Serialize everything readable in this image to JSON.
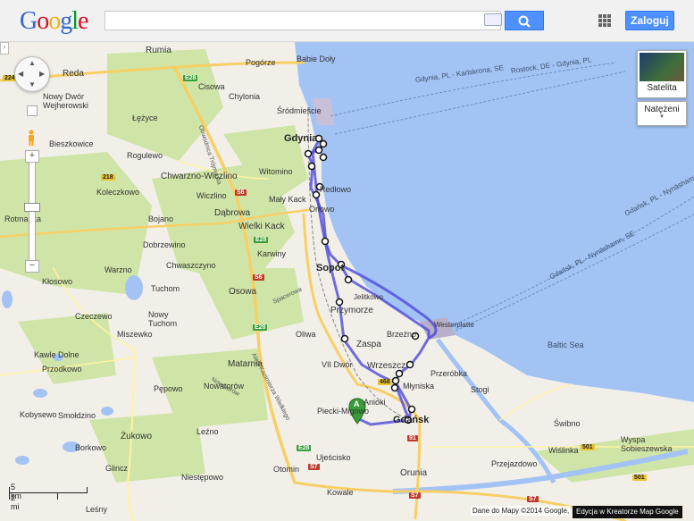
{
  "header": {
    "logo_letters": [
      "G",
      "o",
      "o",
      "g",
      "l",
      "e"
    ],
    "logo_colors": [
      "#3366cc",
      "#d50f25",
      "#eeb211",
      "#3366cc",
      "#009925",
      "#d50f25"
    ],
    "search_value": "",
    "login_label": "Zaloguj"
  },
  "controls": {
    "satellite_label": "Satelita",
    "traffic_label": "Natężeni",
    "zoom_in": "+",
    "zoom_out": "−"
  },
  "map": {
    "places_major": [
      "Gdynia",
      "Sopot",
      "Gdańsk"
    ],
    "places": [
      "Rumia",
      "Reda",
      "Pogórze",
      "Babie Doły",
      "Cisowa",
      "Chylonia",
      "Śródmieście",
      "Nowy Dwór Wejherowski",
      "Łężyce",
      "Bieszkowice",
      "Rogulewo",
      "Chwarzno-Wiczlino",
      "Witomino",
      "Mały Kack",
      "Orłowo",
      "Redłowo",
      "Koleczkowo",
      "Wiczlino",
      "Dąbrowa",
      "Wielki Kack",
      "Bojano",
      "Dobrzewino",
      "Warzno",
      "Chwaszczyno",
      "Tuchom",
      "Nowy Tuchom",
      "Osowa",
      "Oliwa",
      "Przymorze",
      "Zaspa",
      "Brzeźno",
      "Westerplatte",
      "Wrzeszcz",
      "Przeróbka",
      "Stogi",
      "Młyniska",
      "Matarnia",
      "VII Dwór",
      "Kłosowo",
      "Czeczewo",
      "Miszewko",
      "Kawle Dolne",
      "Przodkowo",
      "Pępowo",
      "Kobysewo",
      "Smołdzino",
      "Leźno",
      "Żukowo",
      "Borkowo",
      "Glincz",
      "Niestępowo",
      "Otomin",
      "Kowale",
      "Ujeścisko",
      "Orunia",
      "Piecki-Migowo",
      "Anioki",
      "Przejazdowo",
      "Wiślinka",
      "Wyspa Sobieszewska",
      "Świbno",
      "Rotmanka",
      "Nowatorów",
      "Jelitkowo",
      "Karwiny",
      "Leśny"
    ],
    "sea": "Baltic Sea",
    "ferries": [
      "Gdynia, PL - Karlskrona, SE",
      "Rostock, DE - Gdynia, PL",
      "Gdańsk, PL - Nynäshamn, SE",
      "Gdańsk, PL - Nynäshamn, SE"
    ],
    "roads": [
      "Obwodnica Trójmiasta",
      "Aleja Kazimierza Wielkiego",
      "Spacerowa",
      "Nowatorów"
    ],
    "shields": [
      "224",
      "E28",
      "E28",
      "S6",
      "S6",
      "E28",
      "218",
      "468",
      "E28",
      "91",
      "S7",
      "S7",
      "501",
      "501",
      "S7"
    ],
    "marker_label": "A",
    "scale_km": "5 km",
    "scale_mi": "2 mi"
  },
  "footer": {
    "attribution": "Dane do Mapy ©2014 Google,",
    "edit_label": "Edycja w Kreatorze Map Google"
  },
  "colors": {
    "sea": "#a3c3f4",
    "route": "#4e4ad9",
    "land": "#f2efe9",
    "forest": "#cfe5a7",
    "button": "#4d90fe",
    "marker": "#3a9d3a"
  }
}
